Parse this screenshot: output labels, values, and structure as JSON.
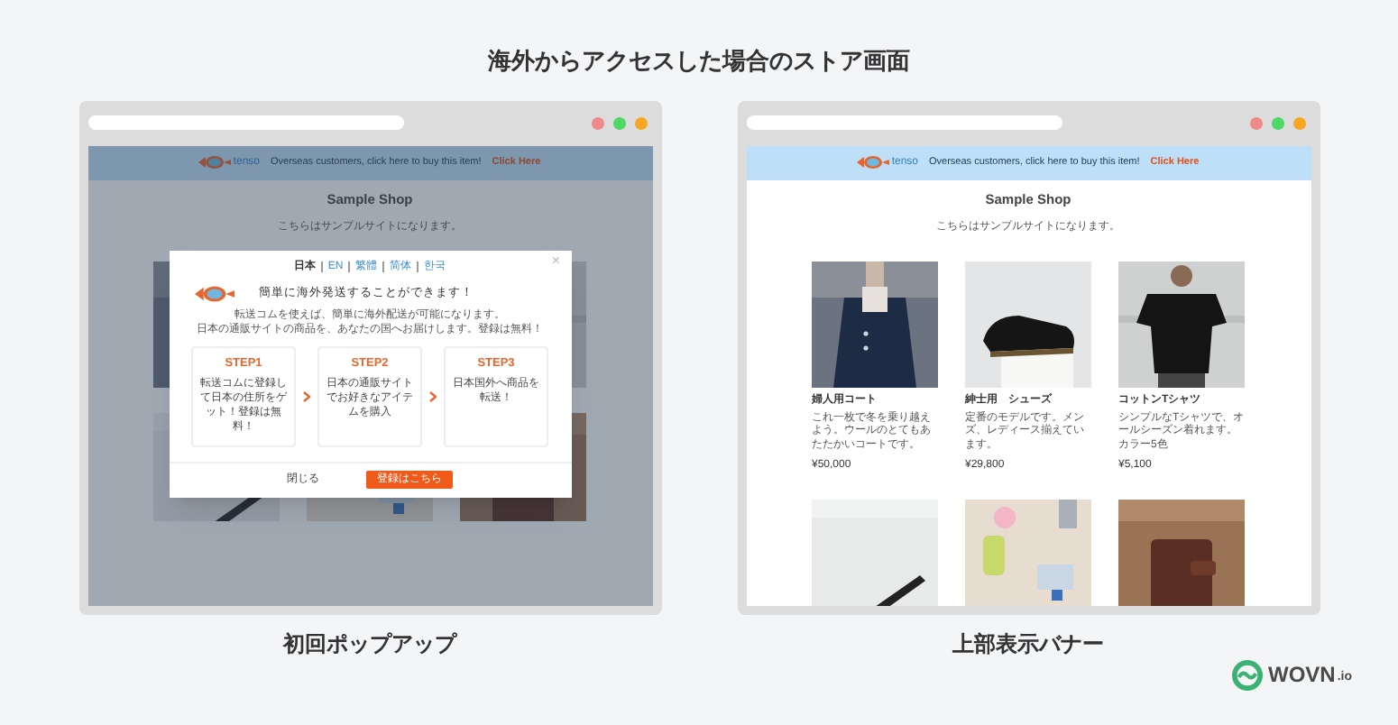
{
  "heading": "海外からアクセスした場合のストア画面",
  "screens": [
    {
      "kind": "popup",
      "caption": "初回ポップアップ",
      "dimmed": true,
      "banner": {
        "logo": "tenso",
        "text": "Overseas customers, click here to buy this item!",
        "link": "Click Here"
      },
      "shop_title": "Sample Shop",
      "shop_subtitle": "こちらはサンプルサイトになります。",
      "products": [
        {
          "kind": "picture"
        },
        {
          "kind": "covered"
        },
        {
          "kind": "picture"
        },
        {
          "kind": "picture"
        },
        {
          "kind": "picture"
        },
        {
          "kind": "picture"
        }
      ],
      "popup": {
        "languages": [
          {
            "label": "日本",
            "selected": true
          },
          {
            "label": "EN",
            "selected": false
          },
          {
            "label": "繁體",
            "selected": false
          },
          {
            "label": "简体",
            "selected": false
          },
          {
            "label": "한국",
            "selected": false
          }
        ],
        "close": "×",
        "title": "簡単に海外発送することができます！",
        "description": [
          "転送コムを使えば、簡単に海外配送が可能になります。",
          "日本の通販サイトの商品を、あなたの国へお届けします。登録は無料！"
        ],
        "steps": [
          {
            "title": "STEP1",
            "text": "転送コムに登録して日本の住所をゲット！登録は無料！"
          },
          {
            "title": "STEP2",
            "text": "日本の通販サイトでお好きなアイテムを購入"
          },
          {
            "title": "STEP3",
            "text": "日本国外へ商品を転送！"
          }
        ],
        "dismiss": "閉じる",
        "register": "登録はこちら"
      }
    },
    {
      "kind": "banner",
      "caption": "上部表示バナー",
      "dimmed": false,
      "banner": {
        "logo": "tenso",
        "text": "Overseas customers, click here to buy this item!",
        "link": "Click Here"
      },
      "shop_title": "Sample Shop",
      "shop_subtitle": "こちらはサンプルサイトになります。",
      "products": [
        {
          "kind": "item",
          "name": "婦人用コート",
          "description": "これ一枚で冬を乗り越えよう。ウールのとてもあたたかいコートです。",
          "price": "¥50,000"
        },
        {
          "kind": "item",
          "name": "紳士用　シューズ",
          "description": "定番のモデルです。メンズ、レディース揃えています。",
          "price": "¥29,800"
        },
        {
          "kind": "item",
          "name": "コットンTシャツ",
          "description": "シンプルなTシャツで、オールシーズン着れます。カラー5色",
          "price": "¥5,100"
        },
        {
          "kind": "picture"
        },
        {
          "kind": "picture"
        },
        {
          "kind": "picture"
        }
      ]
    }
  ],
  "brand": {
    "name": "WOVN",
    "suffix": ".io"
  }
}
